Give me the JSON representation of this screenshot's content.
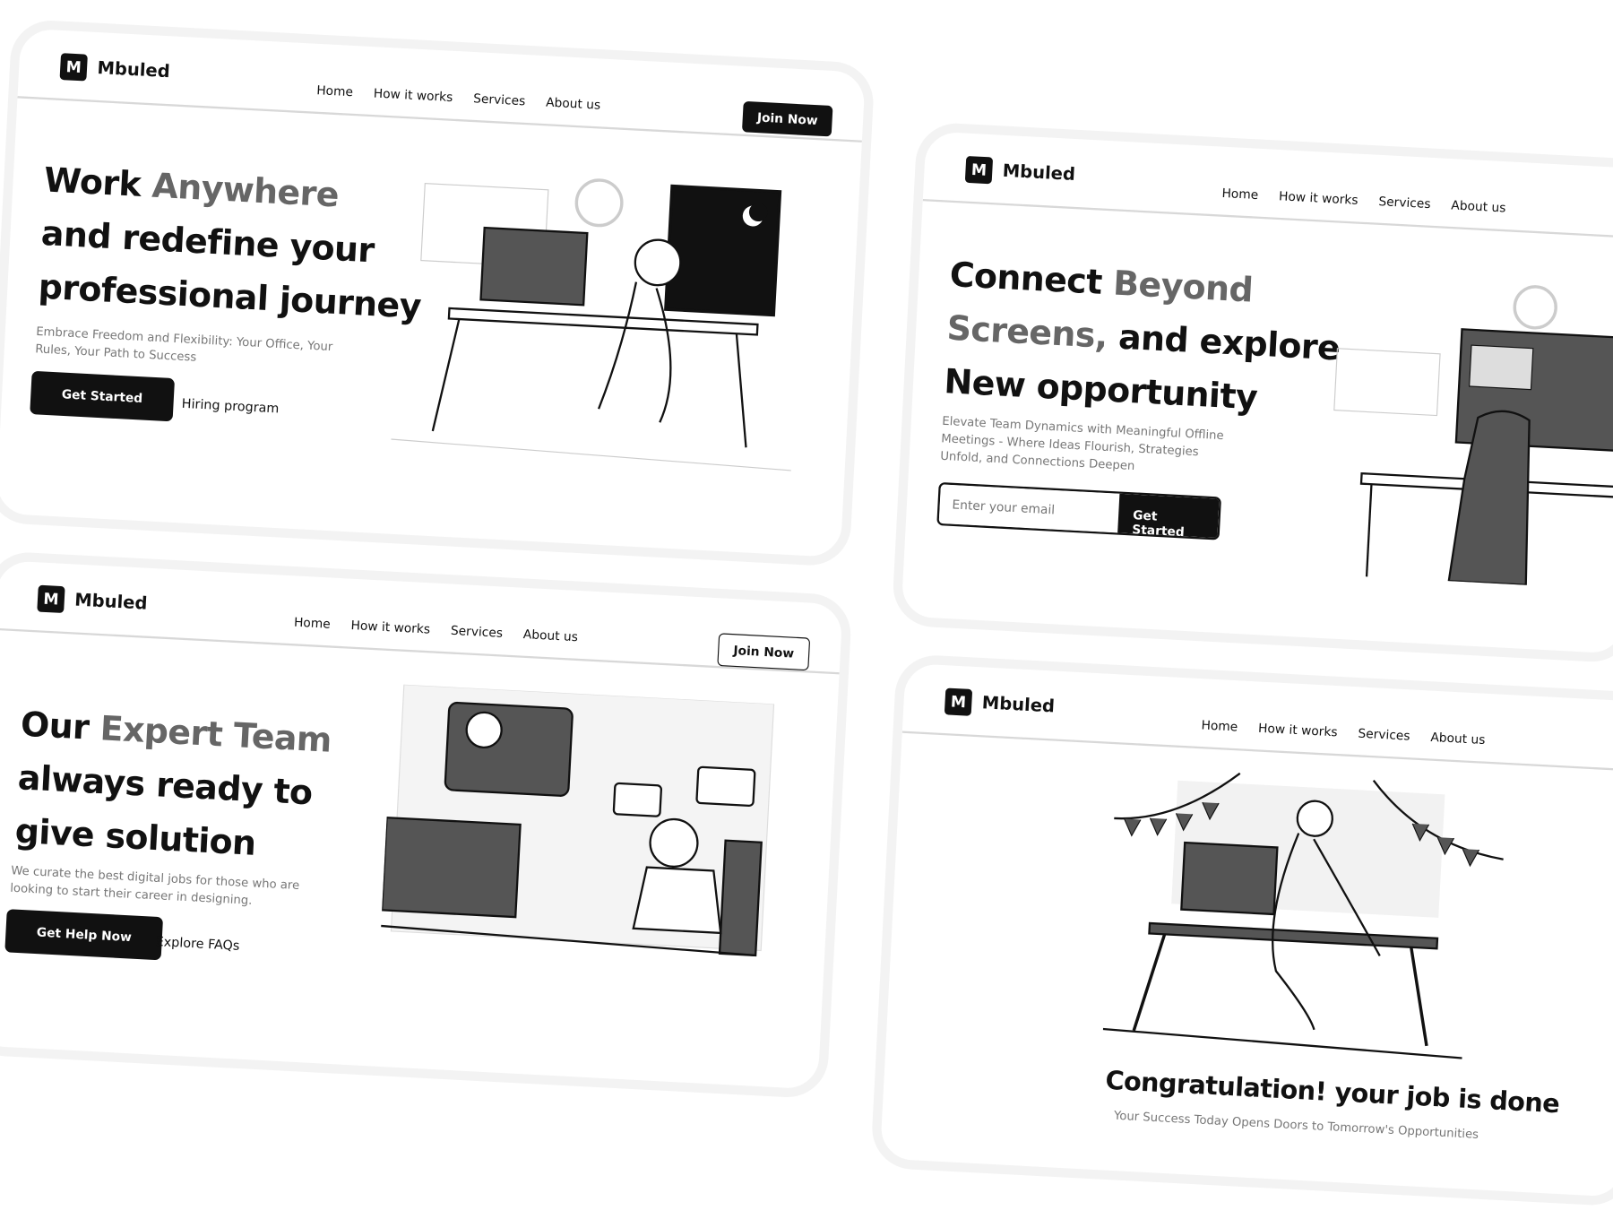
{
  "brand": {
    "name": "Mbuled",
    "mark": "M"
  },
  "nav": [
    "Home",
    "How it works",
    "Services",
    "About us"
  ],
  "card1": {
    "title_a": "Work ",
    "title_b": "Anywhere",
    "title_2": "and redefine your",
    "title_3": "professional journey",
    "subtitle": "Embrace Freedom and Flexibility: Your Office, Your Rules, Your Path to Success",
    "primary": "Get Started",
    "secondary": "Hiring program",
    "join": "Join Now"
  },
  "card2": {
    "title_a": "Connect ",
    "title_b": "Beyond",
    "title_2b": "Screens,",
    "title_2": " and explore",
    "title_3": "New opportunity",
    "subtitle": "Elevate Team Dynamics with Meaningful Offline Meetings - Where Ideas Flourish, Strategies Unfold, and Connections Deepen",
    "email_placeholder": "Enter your email",
    "primary": "Get Started"
  },
  "card3": {
    "title_a": "Our ",
    "title_b": "Expert Team",
    "title_2": "always ready to",
    "title_3": "give solution",
    "subtitle": "We curate the best digital jobs for those who are looking to start their career in designing.",
    "primary": "Get Help Now",
    "secondary": "Explore FAQs",
    "join": "Join Now"
  },
  "card4": {
    "title": "Congratulation! your job is done",
    "subtitle": "Your Success Today Opens Doors to Tomorrow's Opportunities"
  }
}
